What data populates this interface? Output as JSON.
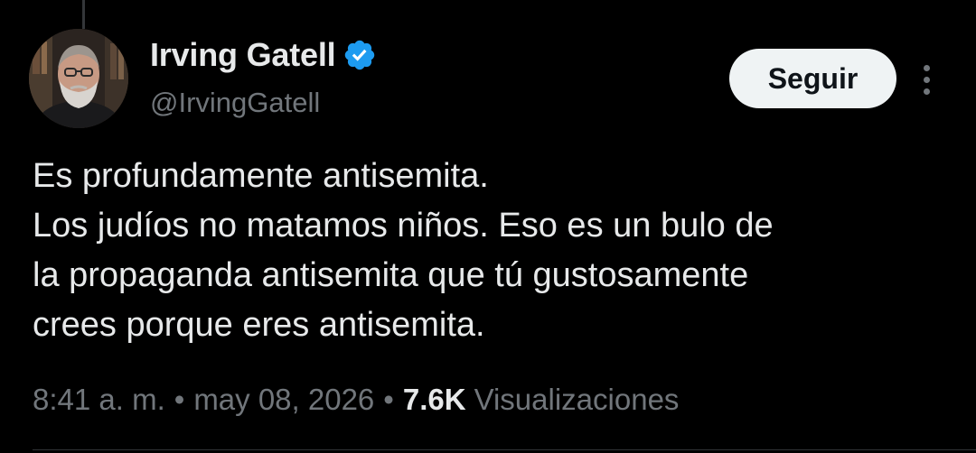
{
  "author": {
    "display_name": "Irving Gatell",
    "handle": "@IrvingGatell",
    "verified_icon": "verified-badge-icon",
    "avatar_icon": "avatar"
  },
  "actions": {
    "follow_label": "Seguir",
    "more_icon": "more-options-icon"
  },
  "tweet": {
    "lines": [
      "Es profundamente antisemita.",
      "Los judíos no matamos niños. Eso es un bulo de",
      "la propaganda antisemita que tú gustosamente",
      "crees porque eres antisemita."
    ]
  },
  "meta": {
    "time": "8:41 a. m.",
    "separator": "•",
    "date": "may 08, 2026",
    "views_count": "7.6K",
    "views_label": "Visualizaciones"
  },
  "colors": {
    "background": "#000000",
    "text_primary": "#e7e9ea",
    "text_secondary": "#71767b",
    "verified_blue": "#1d9bf0",
    "button_bg": "#eff3f4"
  }
}
